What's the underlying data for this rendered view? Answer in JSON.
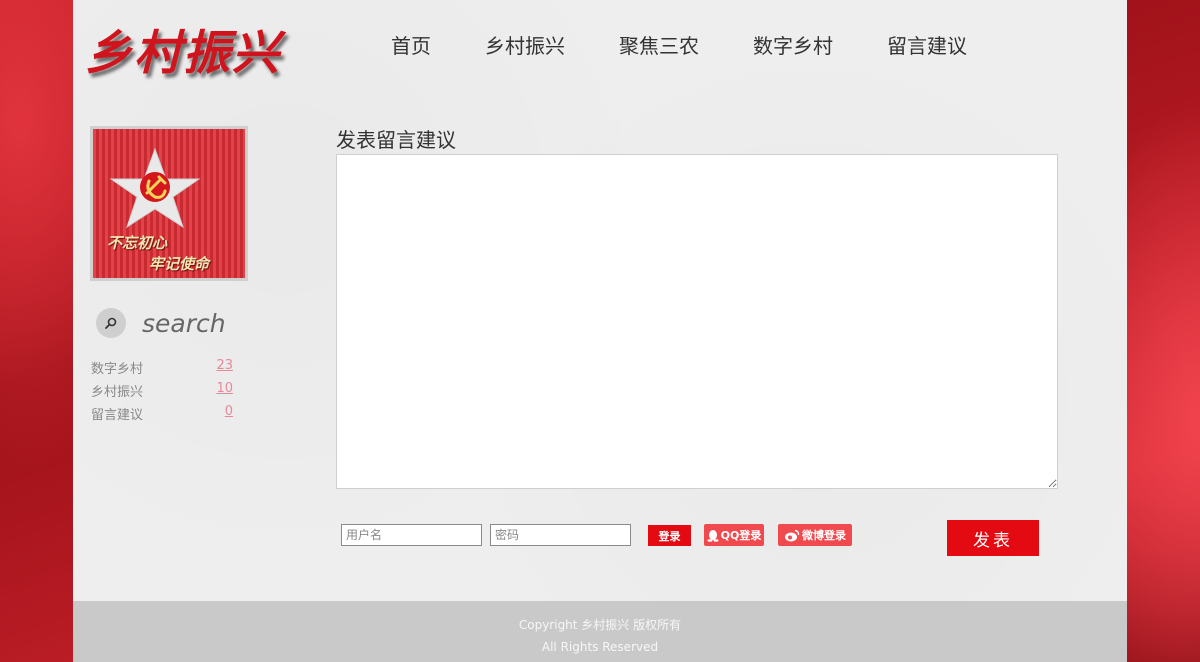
{
  "header": {
    "logo_text": "乡村振兴",
    "nav": [
      "首页",
      "乡村振兴",
      "聚焦三农",
      "数字乡村",
      "留言建议"
    ]
  },
  "sidebar": {
    "banner": {
      "slogan_line1": "不忘初心",
      "slogan_line2": "牢记使命"
    },
    "search_label": "search",
    "categories": [
      {
        "name": "数字乡村",
        "count": "23"
      },
      {
        "name": "乡村振兴",
        "count": "10"
      },
      {
        "name": "留言建议",
        "count": "0"
      }
    ]
  },
  "form": {
    "title": "发表留言建议",
    "message_value": "",
    "username_placeholder": "用户名",
    "password_placeholder": "密码",
    "login_label": "登录",
    "qq_login_label": "QQ登录",
    "weibo_login_label": "微博登录",
    "publish_label": "发表"
  },
  "footer": {
    "copyright": "Copyright 乡村振兴 版权所有",
    "rights": "All Rights Reserved"
  },
  "colors": {
    "accent_red": "#e30a12",
    "logo_red": "#d0141d",
    "social_red": "#f04a4f",
    "footer_gray": "#c9c9c9"
  },
  "icons": {
    "search": "magnifier-icon",
    "qq": "qq-penguin-icon",
    "weibo": "weibo-icon",
    "banner": "party-emblem-star-icon"
  }
}
